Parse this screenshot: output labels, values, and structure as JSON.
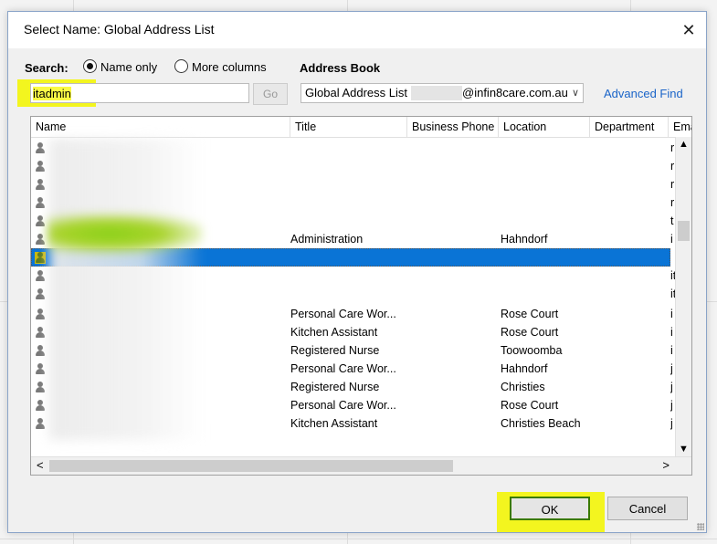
{
  "dialog": {
    "title": "Select Name: Global Address List",
    "close_glyph": "✕"
  },
  "search": {
    "label": "Search:",
    "value": "itadmin",
    "go_label": "Go",
    "options": [
      {
        "label": "Name only",
        "selected": true
      },
      {
        "label": "More columns",
        "selected": false
      }
    ]
  },
  "address_book": {
    "label": "Address Book",
    "selected_part1": "Global Address List",
    "selected_part2": "@infin8care.com.au",
    "advanced_find": "Advanced Find"
  },
  "columns": [
    "Name",
    "Title",
    "Business Phone",
    "Location",
    "Department",
    "Email"
  ],
  "column_display": [
    "Name",
    "Title",
    "Business Phone",
    "Location",
    "Department",
    "Ema"
  ],
  "rows": [
    {
      "title": "",
      "location": "",
      "email": "r"
    },
    {
      "title": "",
      "location": "",
      "email": "r"
    },
    {
      "title": "",
      "location": "",
      "email": "r"
    },
    {
      "title": "",
      "location": "",
      "email": "r"
    },
    {
      "title": "",
      "location": "",
      "email": "t"
    },
    {
      "title": "Administration",
      "location": "Hahndorf",
      "email": "i"
    },
    {
      "title": "",
      "location": "",
      "email": "i",
      "selected": true
    },
    {
      "title": "",
      "location": "",
      "email": "it"
    },
    {
      "title": "",
      "location": "",
      "email": "it"
    },
    {
      "title": "Personal Care Wor...",
      "location": "Rose Court",
      "email": "i"
    },
    {
      "title": "Kitchen Assistant",
      "location": "Rose Court",
      "email": "i"
    },
    {
      "title": "Registered Nurse",
      "location": "Toowoomba",
      "email": "i"
    },
    {
      "title": "Personal Care Wor...",
      "location": "Hahndorf",
      "email": "j"
    },
    {
      "title": "Registered Nurse",
      "location": "Christies",
      "email": "j"
    },
    {
      "title": "Personal Care Wor...",
      "location": "Rose Court",
      "email": "j"
    },
    {
      "title": "Kitchen Assistant",
      "location": "Christies Beach",
      "email": "j"
    }
  ],
  "buttons": {
    "ok": "OK",
    "cancel": "Cancel"
  },
  "colors": {
    "highlight": "#f3f51f",
    "selection": "#0a74d6",
    "link": "#1a64c8"
  },
  "icons": {
    "contact": "person-icon",
    "close": "close-icon",
    "dropdown": "chevron-down-icon"
  }
}
